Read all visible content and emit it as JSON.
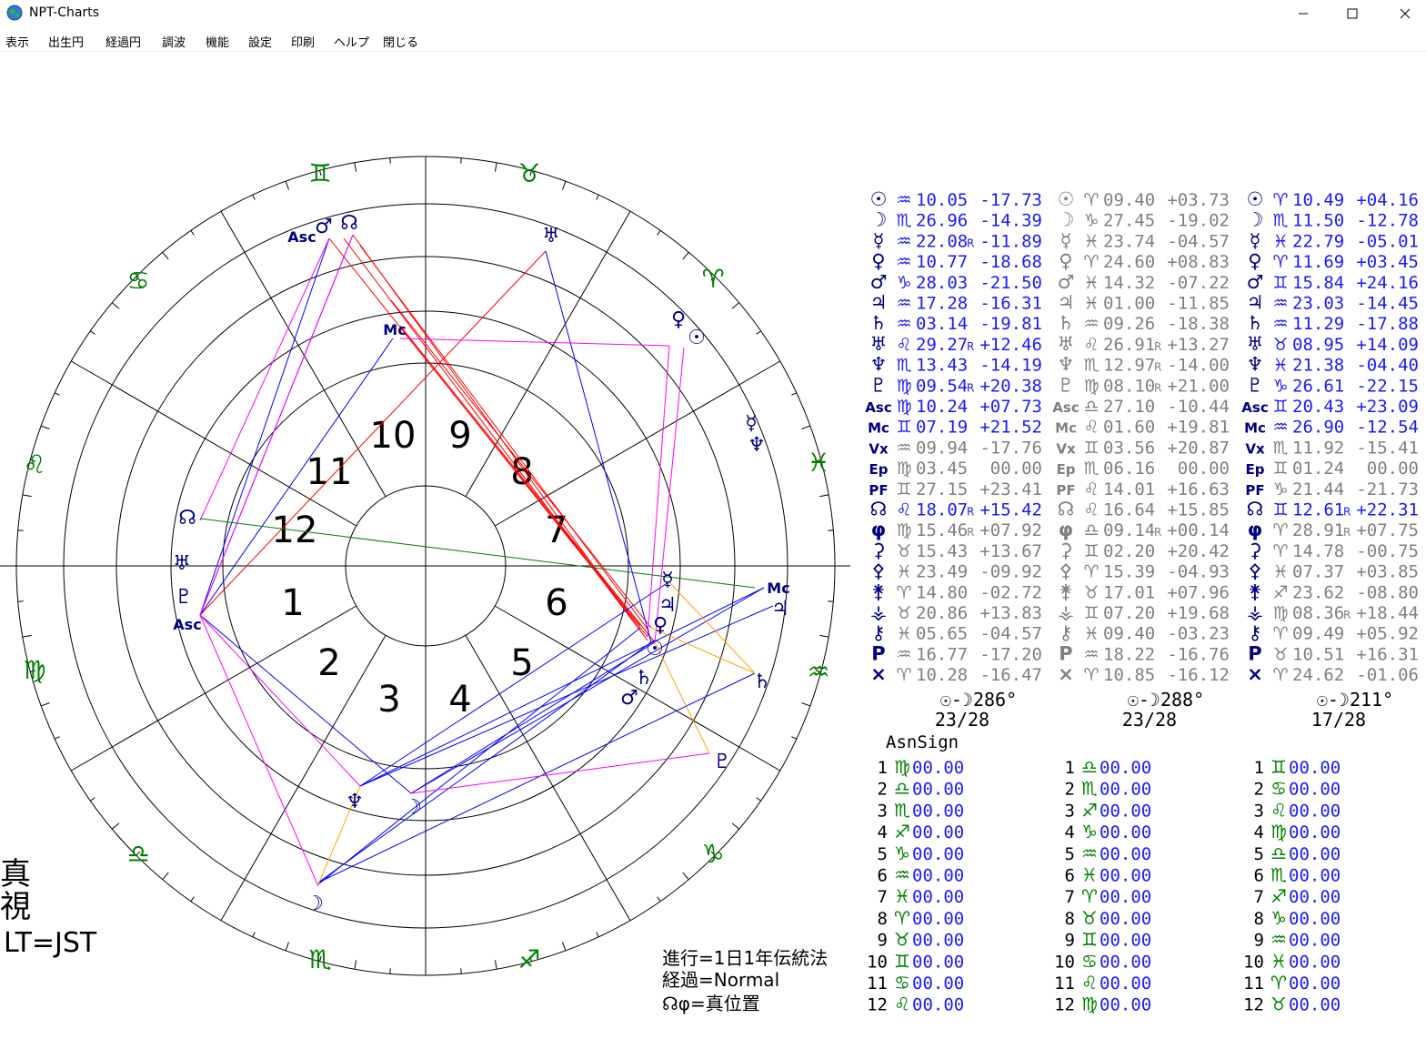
{
  "window": {
    "title": "NPT-Charts",
    "controls": {
      "minimize": "—",
      "maximize": "☐",
      "close": "✕"
    }
  },
  "menu": [
    "表示",
    "出生円",
    "経過円",
    "調波",
    "機能",
    "設定",
    "印刷",
    "ヘルプ",
    "閉じる"
  ],
  "colors": {
    "sign": "#008000",
    "planet_natal": "#000080",
    "table_blue": "#1a1aff",
    "grey": "#808080",
    "red": "#ff0000",
    "blue": "#0000ff",
    "magenta": "#ff00ff",
    "green": "#008000",
    "orange": "#ffa500"
  },
  "wheel": {
    "house_numbers": [
      "1",
      "2",
      "3",
      "4",
      "5",
      "6",
      "7",
      "8",
      "9",
      "10",
      "11",
      "12"
    ],
    "sign_glyphs": {
      "aries": "♈",
      "taurus": "♉",
      "gemini": "♊",
      "cancer": "♋",
      "leo": "♌",
      "virgo": "♍",
      "libra": "♎",
      "scorpio": "♏",
      "sagittarius": "♐",
      "capricorn": "♑",
      "aquarius": "♒",
      "pisces": "♓"
    },
    "ring_labels": {
      "asc": "Asc",
      "mc": "Mc",
      "node": "☊",
      "mars": "♂",
      "uranus": "♅",
      "venus": "♀",
      "sun": "☉",
      "mercury": "☿",
      "neptune": "♆",
      "jupiter": "♃",
      "saturn": "♄",
      "pluto": "♇",
      "moon": "☽"
    }
  },
  "left_notes": [
    "真",
    "視",
    "LT=JST"
  ],
  "bottom_notes": [
    "進行=1日1年伝統法",
    "経過=Normal",
    "☊φ=真位置"
  ],
  "positions": {
    "columns": [
      {
        "rows": [
          {
            "sym": "☉",
            "sign": "♒",
            "val": "10.05",
            "r": "",
            "lat": "-17.73",
            "c": "blue"
          },
          {
            "sym": "☽",
            "sign": "♏",
            "val": "26.96",
            "r": "",
            "lat": "-14.39",
            "c": "blue"
          },
          {
            "sym": "☿",
            "sign": "♒",
            "val": "22.08",
            "r": "R",
            "lat": "-11.89",
            "c": "blue"
          },
          {
            "sym": "♀",
            "sign": "♒",
            "val": "10.77",
            "r": "",
            "lat": "-18.68",
            "c": "blue"
          },
          {
            "sym": "♂",
            "sign": "♑",
            "val": "28.03",
            "r": "",
            "lat": "-21.50",
            "c": "blue"
          },
          {
            "sym": "♃",
            "sign": "♒",
            "val": "17.28",
            "r": "",
            "lat": "-16.31",
            "c": "blue"
          },
          {
            "sym": "♄",
            "sign": "♒",
            "val": "03.14",
            "r": "",
            "lat": "-19.81",
            "c": "blue"
          },
          {
            "sym": "♅",
            "sign": "♌",
            "val": "29.27",
            "r": "R",
            "lat": "+12.46",
            "c": "blue"
          },
          {
            "sym": "♆",
            "sign": "♏",
            "val": "13.43",
            "r": "",
            "lat": "-14.19",
            "c": "blue"
          },
          {
            "sym": "♇",
            "sign": "♍",
            "val": "09.54",
            "r": "R",
            "lat": "+20.38",
            "c": "blue"
          },
          {
            "sym": "Asc",
            "sign": "♍",
            "val": "10.24",
            "r": "",
            "lat": "+07.73",
            "c": "blue"
          },
          {
            "sym": "Mc",
            "sign": "♊",
            "val": "07.19",
            "r": "",
            "lat": "+21.52",
            "c": "blue"
          },
          {
            "sym": "Vx",
            "sign": "♒",
            "val": "09.94",
            "r": "",
            "lat": "-17.76",
            "c": "grey"
          },
          {
            "sym": "Ep",
            "sign": "♍",
            "val": "03.45",
            "r": "",
            "lat": "00.00",
            "c": "grey"
          },
          {
            "sym": "PF",
            "sign": "♊",
            "val": "27.15",
            "r": "",
            "lat": "+23.41",
            "c": "grey"
          },
          {
            "sym": "☊",
            "sign": "♌",
            "val": "18.07",
            "r": "R",
            "lat": "+15.42",
            "c": "blue"
          },
          {
            "sym": "φ",
            "sign": "♍",
            "val": "15.46",
            "r": "R",
            "lat": "+07.92",
            "c": "grey"
          },
          {
            "sym": "⚳",
            "sign": "♉",
            "val": "15.43",
            "r": "",
            "lat": "+13.67",
            "c": "grey"
          },
          {
            "sym": "⚴",
            "sign": "♓",
            "val": "23.49",
            "r": "",
            "lat": "-09.92",
            "c": "grey"
          },
          {
            "sym": "⚵",
            "sign": "♈",
            "val": "14.80",
            "r": "",
            "lat": "-02.72",
            "c": "grey"
          },
          {
            "sym": "⚶",
            "sign": "♉",
            "val": "20.86",
            "r": "",
            "lat": "+13.83",
            "c": "grey"
          },
          {
            "sym": "⚷",
            "sign": "♓",
            "val": "05.65",
            "r": "",
            "lat": "-04.57",
            "c": "grey"
          },
          {
            "sym": "P",
            "sign": "♒",
            "val": "16.77",
            "r": "",
            "lat": "-17.20",
            "c": "grey"
          },
          {
            "sym": "×",
            "sign": "♈",
            "val": "10.28",
            "r": "",
            "lat": "-16.47",
            "c": "grey"
          }
        ],
        "phase": "☉-☽286°",
        "frac": "23/28"
      },
      {
        "rows": [
          {
            "sym": "☉",
            "sign": "♈",
            "val": "09.40",
            "r": "",
            "lat": "+03.73",
            "c": "grey"
          },
          {
            "sym": "☽",
            "sign": "♑",
            "val": "27.45",
            "r": "",
            "lat": "-19.02",
            "c": "grey"
          },
          {
            "sym": "☿",
            "sign": "♓",
            "val": "23.74",
            "r": "",
            "lat": "-04.57",
            "c": "grey"
          },
          {
            "sym": "♀",
            "sign": "♈",
            "val": "24.60",
            "r": "",
            "lat": "+08.83",
            "c": "grey"
          },
          {
            "sym": "♂",
            "sign": "♓",
            "val": "14.32",
            "r": "",
            "lat": "-07.22",
            "c": "grey"
          },
          {
            "sym": "♃",
            "sign": "♓",
            "val": "01.00",
            "r": "",
            "lat": "-11.85",
            "c": "grey"
          },
          {
            "sym": "♄",
            "sign": "♒",
            "val": "09.26",
            "r": "",
            "lat": "-18.38",
            "c": "grey"
          },
          {
            "sym": "♅",
            "sign": "♌",
            "val": "26.91",
            "r": "R",
            "lat": "+13.27",
            "c": "grey"
          },
          {
            "sym": "♆",
            "sign": "♏",
            "val": "12.97",
            "r": "R",
            "lat": "-14.00",
            "c": "grey"
          },
          {
            "sym": "♇",
            "sign": "♍",
            "val": "08.10",
            "r": "R",
            "lat": "+21.00",
            "c": "grey"
          },
          {
            "sym": "Asc",
            "sign": "♎",
            "val": "27.10",
            "r": "",
            "lat": "-10.44",
            "c": "grey"
          },
          {
            "sym": "Mc",
            "sign": "♌",
            "val": "01.60",
            "r": "",
            "lat": "+19.81",
            "c": "grey"
          },
          {
            "sym": "Vx",
            "sign": "♊",
            "val": "03.56",
            "r": "",
            "lat": "+20.87",
            "c": "grey"
          },
          {
            "sym": "Ep",
            "sign": "♏",
            "val": "06.16",
            "r": "",
            "lat": "00.00",
            "c": "grey"
          },
          {
            "sym": "PF",
            "sign": "♌",
            "val": "14.01",
            "r": "",
            "lat": "+16.63",
            "c": "grey"
          },
          {
            "sym": "☊",
            "sign": "♌",
            "val": "16.64",
            "r": "",
            "lat": "+15.85",
            "c": "grey"
          },
          {
            "sym": "φ",
            "sign": "♎",
            "val": "09.14",
            "r": "R",
            "lat": "+00.14",
            "c": "grey"
          },
          {
            "sym": "⚳",
            "sign": "♊",
            "val": "02.20",
            "r": "",
            "lat": "+20.42",
            "c": "grey"
          },
          {
            "sym": "⚴",
            "sign": "♈",
            "val": "15.39",
            "r": "",
            "lat": "-04.93",
            "c": "grey"
          },
          {
            "sym": "⚵",
            "sign": "♉",
            "val": "17.01",
            "r": "",
            "lat": "+07.96",
            "c": "grey"
          },
          {
            "sym": "⚶",
            "sign": "♊",
            "val": "07.20",
            "r": "",
            "lat": "+19.68",
            "c": "grey"
          },
          {
            "sym": "⚷",
            "sign": "♓",
            "val": "09.40",
            "r": "",
            "lat": "-03.23",
            "c": "grey"
          },
          {
            "sym": "P",
            "sign": "♒",
            "val": "18.22",
            "r": "",
            "lat": "-16.76",
            "c": "grey"
          },
          {
            "sym": "×",
            "sign": "♈",
            "val": "10.85",
            "r": "",
            "lat": "-16.12",
            "c": "grey"
          }
        ],
        "phase": "☉-☽288°",
        "frac": "23/28"
      },
      {
        "rows": [
          {
            "sym": "☉",
            "sign": "♈",
            "val": "10.49",
            "r": "",
            "lat": "+04.16",
            "c": "blue"
          },
          {
            "sym": "☽",
            "sign": "♏",
            "val": "11.50",
            "r": "",
            "lat": "-12.78",
            "c": "blue"
          },
          {
            "sym": "☿",
            "sign": "♓",
            "val": "22.79",
            "r": "",
            "lat": "-05.01",
            "c": "blue"
          },
          {
            "sym": "♀",
            "sign": "♈",
            "val": "11.69",
            "r": "",
            "lat": "+03.45",
            "c": "blue"
          },
          {
            "sym": "♂",
            "sign": "♊",
            "val": "15.84",
            "r": "",
            "lat": "+24.16",
            "c": "blue"
          },
          {
            "sym": "♃",
            "sign": "♒",
            "val": "23.03",
            "r": "",
            "lat": "-14.45",
            "c": "blue"
          },
          {
            "sym": "♄",
            "sign": "♒",
            "val": "11.29",
            "r": "",
            "lat": "-17.88",
            "c": "blue"
          },
          {
            "sym": "♅",
            "sign": "♉",
            "val": "08.95",
            "r": "",
            "lat": "+14.09",
            "c": "blue"
          },
          {
            "sym": "♆",
            "sign": "♓",
            "val": "21.38",
            "r": "",
            "lat": "-04.40",
            "c": "blue"
          },
          {
            "sym": "♇",
            "sign": "♑",
            "val": "26.61",
            "r": "",
            "lat": "-22.15",
            "c": "blue"
          },
          {
            "sym": "Asc",
            "sign": "♊",
            "val": "20.43",
            "r": "",
            "lat": "+23.09",
            "c": "blue"
          },
          {
            "sym": "Mc",
            "sign": "♒",
            "val": "26.90",
            "r": "",
            "lat": "-12.54",
            "c": "blue"
          },
          {
            "sym": "Vx",
            "sign": "♏",
            "val": "11.92",
            "r": "",
            "lat": "-15.41",
            "c": "grey"
          },
          {
            "sym": "Ep",
            "sign": "♊",
            "val": "01.24",
            "r": "",
            "lat": "00.00",
            "c": "grey"
          },
          {
            "sym": "PF",
            "sign": "♑",
            "val": "21.44",
            "r": "",
            "lat": "-21.73",
            "c": "grey"
          },
          {
            "sym": "☊",
            "sign": "♊",
            "val": "12.61",
            "r": "R",
            "lat": "+22.31",
            "c": "blue"
          },
          {
            "sym": "φ",
            "sign": "♈",
            "val": "28.91",
            "r": "R",
            "lat": "+07.75",
            "c": "grey"
          },
          {
            "sym": "⚳",
            "sign": "♈",
            "val": "14.78",
            "r": "",
            "lat": "-00.75",
            "c": "grey"
          },
          {
            "sym": "⚴",
            "sign": "♓",
            "val": "07.37",
            "r": "",
            "lat": "+03.85",
            "c": "grey"
          },
          {
            "sym": "⚵",
            "sign": "♐",
            "val": "23.62",
            "r": "",
            "lat": "-08.80",
            "c": "grey"
          },
          {
            "sym": "⚶",
            "sign": "♍",
            "val": "08.36",
            "r": "R",
            "lat": "+18.44",
            "c": "grey"
          },
          {
            "sym": "⚷",
            "sign": "♈",
            "val": "09.49",
            "r": "",
            "lat": "+05.92",
            "c": "grey"
          },
          {
            "sym": "P",
            "sign": "♉",
            "val": "10.51",
            "r": "",
            "lat": "+16.31",
            "c": "grey"
          },
          {
            "sym": "×",
            "sign": "♈",
            "val": "24.62",
            "r": "",
            "lat": "-01.06",
            "c": "grey"
          }
        ],
        "phase": "☉-☽211°",
        "frac": "17/28"
      }
    ]
  },
  "asn": {
    "label": "AsnSign",
    "columns": [
      {
        "rows": [
          {
            "n": "1",
            "sign": "♍",
            "val": "00.00"
          },
          {
            "n": "2",
            "sign": "♎",
            "val": "00.00"
          },
          {
            "n": "3",
            "sign": "♏",
            "val": "00.00"
          },
          {
            "n": "4",
            "sign": "♐",
            "val": "00.00"
          },
          {
            "n": "5",
            "sign": "♑",
            "val": "00.00"
          },
          {
            "n": "6",
            "sign": "♒",
            "val": "00.00"
          },
          {
            "n": "7",
            "sign": "♓",
            "val": "00.00"
          },
          {
            "n": "8",
            "sign": "♈",
            "val": "00.00"
          },
          {
            "n": "9",
            "sign": "♉",
            "val": "00.00"
          },
          {
            "n": "10",
            "sign": "♊",
            "val": "00.00"
          },
          {
            "n": "11",
            "sign": "♋",
            "val": "00.00"
          },
          {
            "n": "12",
            "sign": "♌",
            "val": "00.00"
          }
        ]
      },
      {
        "rows": [
          {
            "n": "1",
            "sign": "♎",
            "val": "00.00"
          },
          {
            "n": "2",
            "sign": "♏",
            "val": "00.00"
          },
          {
            "n": "3",
            "sign": "♐",
            "val": "00.00"
          },
          {
            "n": "4",
            "sign": "♑",
            "val": "00.00"
          },
          {
            "n": "5",
            "sign": "♒",
            "val": "00.00"
          },
          {
            "n": "6",
            "sign": "♓",
            "val": "00.00"
          },
          {
            "n": "7",
            "sign": "♈",
            "val": "00.00"
          },
          {
            "n": "8",
            "sign": "♉",
            "val": "00.00"
          },
          {
            "n": "9",
            "sign": "♊",
            "val": "00.00"
          },
          {
            "n": "10",
            "sign": "♋",
            "val": "00.00"
          },
          {
            "n": "11",
            "sign": "♌",
            "val": "00.00"
          },
          {
            "n": "12",
            "sign": "♍",
            "val": "00.00"
          }
        ]
      },
      {
        "rows": [
          {
            "n": "1",
            "sign": "♊",
            "val": "00.00"
          },
          {
            "n": "2",
            "sign": "♋",
            "val": "00.00"
          },
          {
            "n": "3",
            "sign": "♌",
            "val": "00.00"
          },
          {
            "n": "4",
            "sign": "♍",
            "val": "00.00"
          },
          {
            "n": "5",
            "sign": "♎",
            "val": "00.00"
          },
          {
            "n": "6",
            "sign": "♏",
            "val": "00.00"
          },
          {
            "n": "7",
            "sign": "♐",
            "val": "00.00"
          },
          {
            "n": "8",
            "sign": "♑",
            "val": "00.00"
          },
          {
            "n": "9",
            "sign": "♒",
            "val": "00.00"
          },
          {
            "n": "10",
            "sign": "♓",
            "val": "00.00"
          },
          {
            "n": "11",
            "sign": "♈",
            "val": "00.00"
          },
          {
            "n": "12",
            "sign": "♉",
            "val": "00.00"
          }
        ]
      }
    ]
  }
}
